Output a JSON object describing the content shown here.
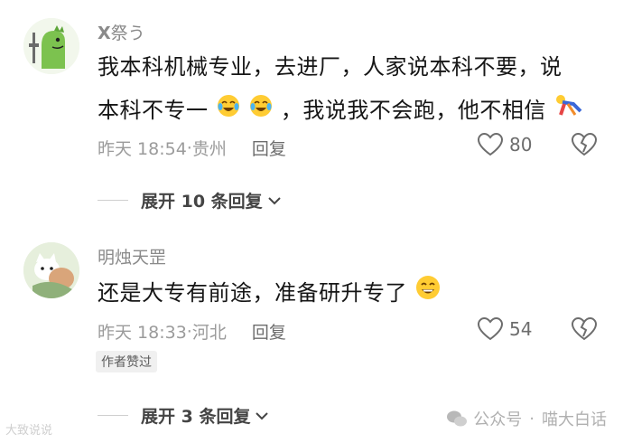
{
  "comments": [
    {
      "username": "𝗫祭う",
      "text_line1": "我本科机械专业，去进厂，人家说本科不要，说",
      "text_line2_a": "本科不专一",
      "text_line2_b": "，我说我不会跑，他不相信",
      "time": "昨天 18:54",
      "location": "贵州",
      "reply": "回复",
      "likes": "80",
      "expand": "展开 10 条回复",
      "avatar": "green-dinosaur-avatar",
      "emojis": [
        "crying-laughing-emoji",
        "crying-laughing-emoji",
        "running-figure-emoji"
      ]
    },
    {
      "username": "明烛天罡",
      "text": "还是大专有前途，准备研升专了",
      "time": "昨天 18:33",
      "location": "河北",
      "reply": "回复",
      "likes": "54",
      "badge": "作者赞过",
      "expand": "展开 3 条回复",
      "avatar": "cat-meme-avatar",
      "emojis": [
        "grinning-emoji"
      ]
    }
  ],
  "watermark": {
    "left": "大致说说",
    "right_a": "公众号",
    "right_b": "喵大白话"
  }
}
